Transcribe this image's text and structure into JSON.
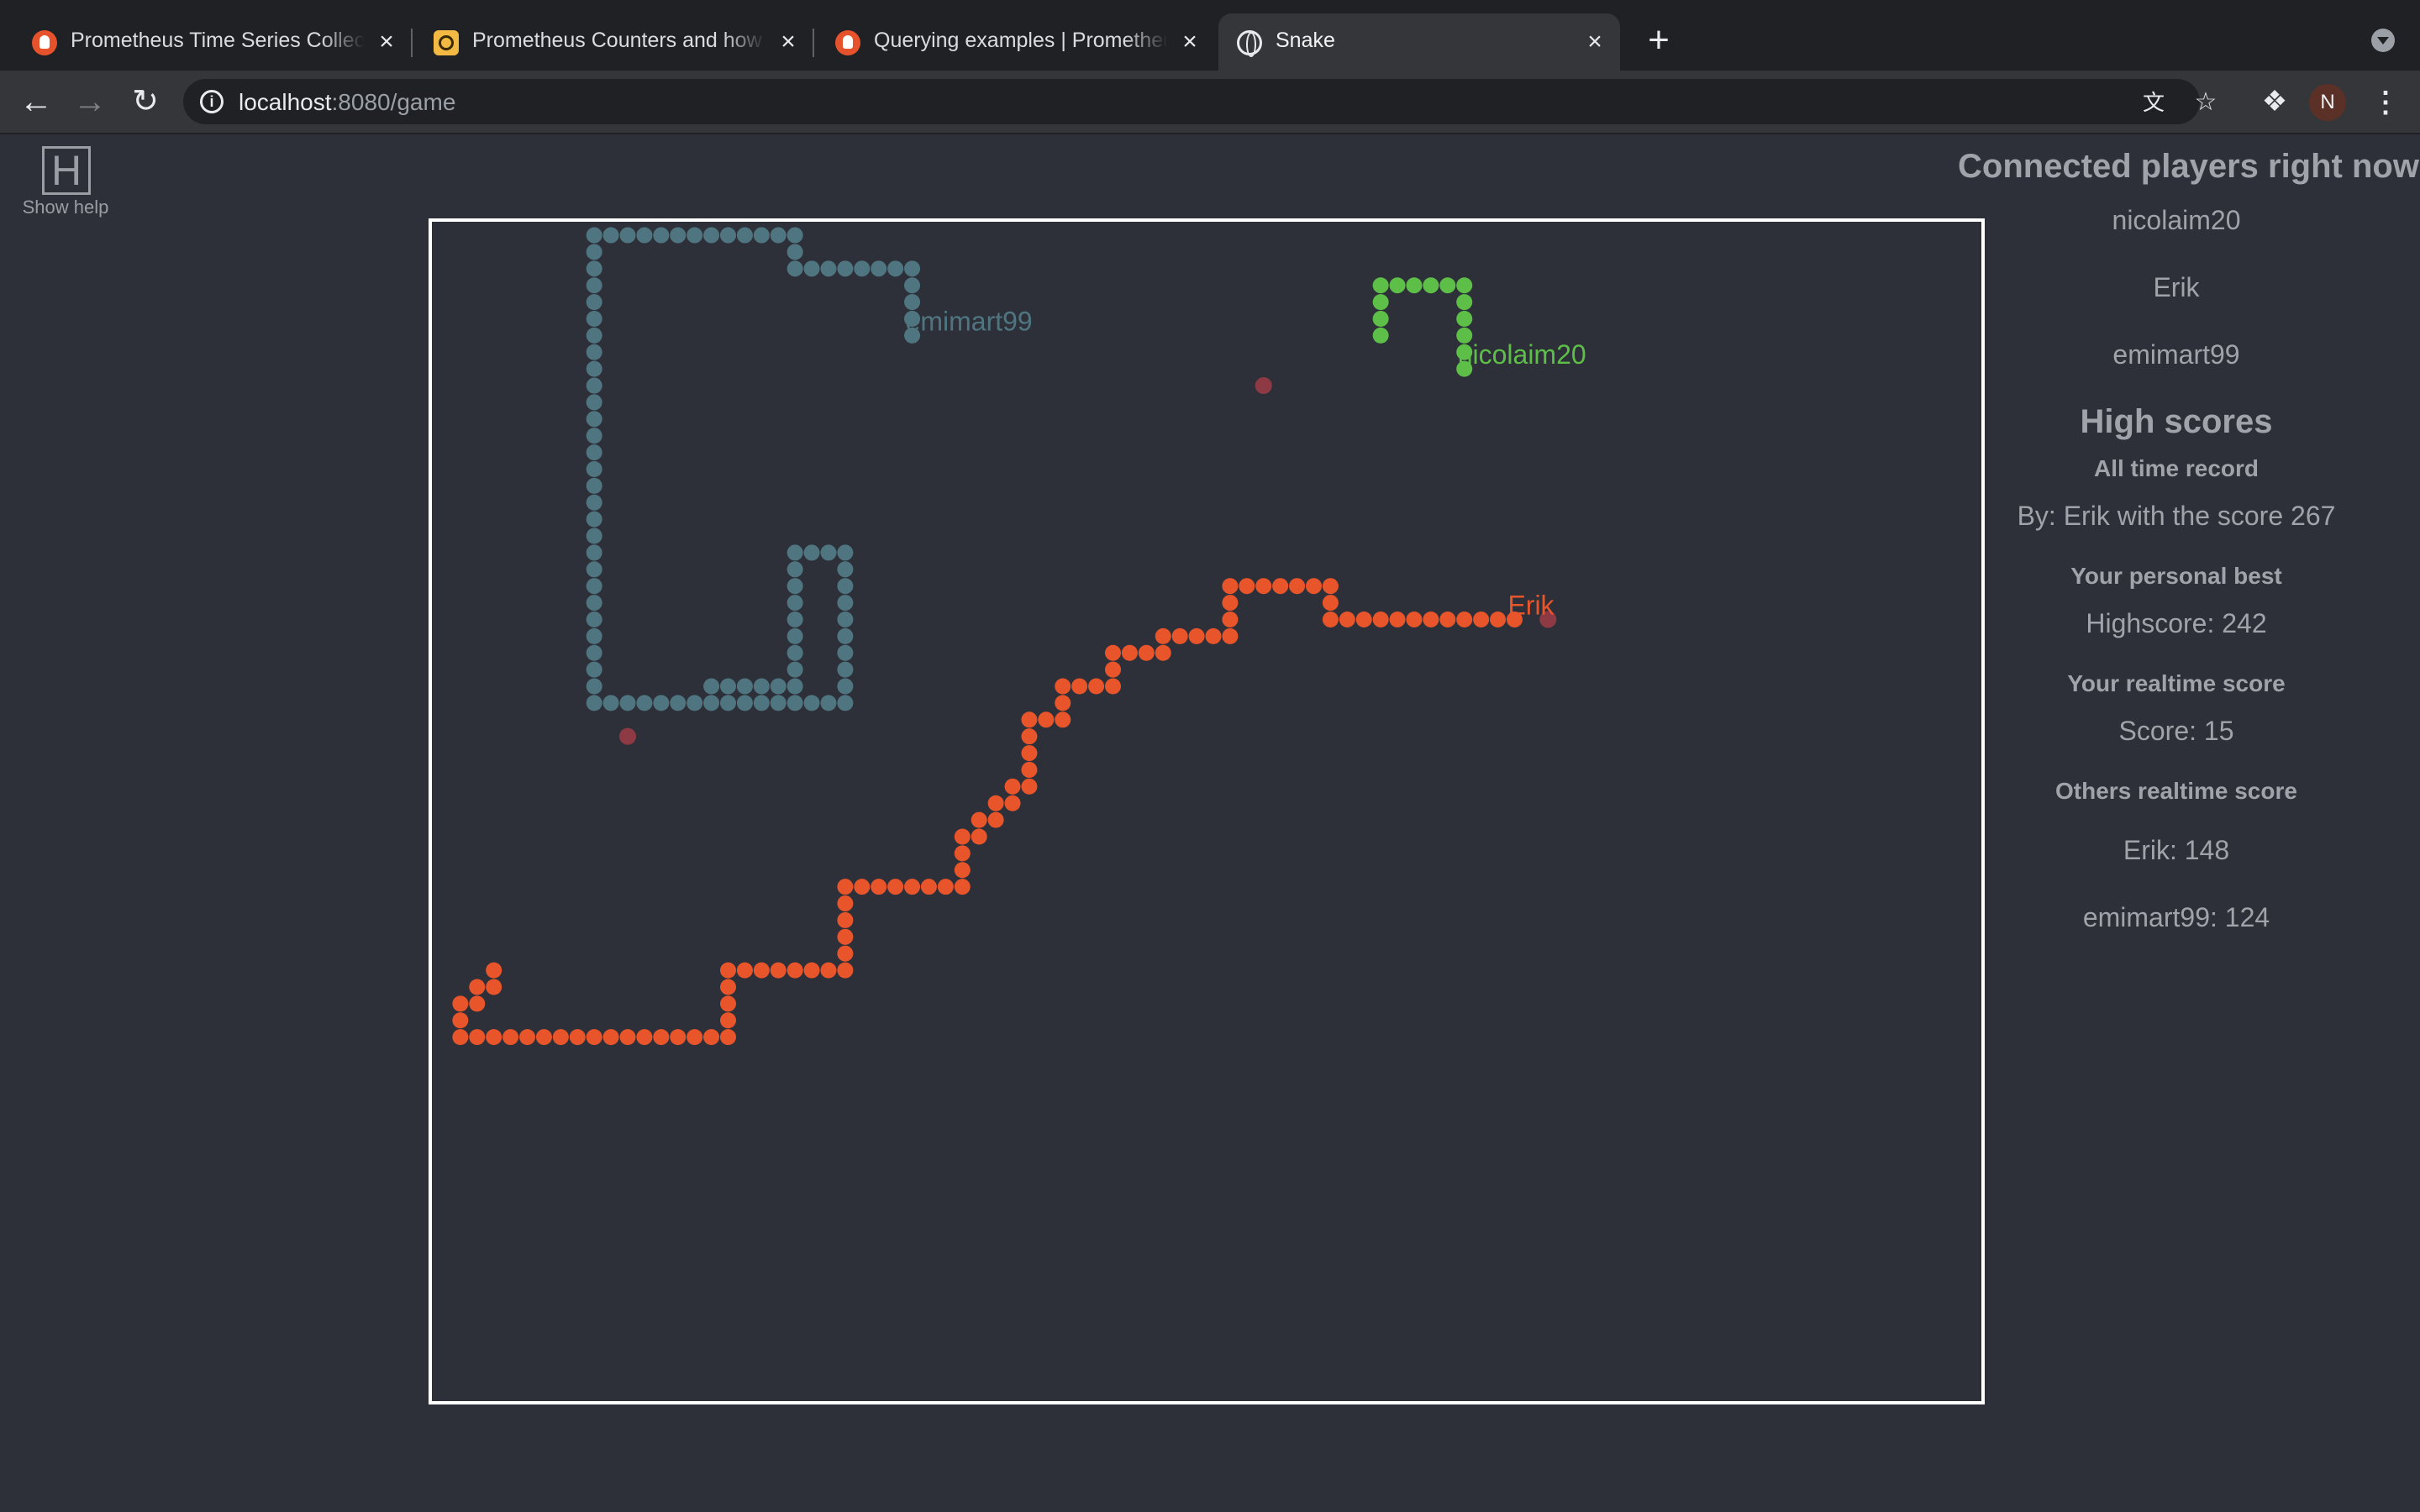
{
  "browser": {
    "tabs": [
      {
        "title": "Prometheus Time Series Collection and Processing Server",
        "icon": "prometheus-icon",
        "active": false
      },
      {
        "title": "Prometheus Counters and how to deal with them",
        "icon": "q-site-icon",
        "active": false
      },
      {
        "title": "Querying examples | Prometheus",
        "icon": "prometheus-icon",
        "active": false
      },
      {
        "title": "Snake",
        "icon": "globe-icon",
        "active": true
      }
    ],
    "url_host": "localhost",
    "url_path": ":8080/game",
    "profile_initial": "N"
  },
  "help": {
    "key": "H",
    "label": "Show help"
  },
  "sidebar": {
    "connected_heading": "Connected players right now",
    "connected_players": [
      "nicolaim20",
      "Erik",
      "emimart99"
    ],
    "high_scores_heading": "High scores",
    "all_time_heading": "All time record",
    "all_time_text": "By: Erik with the score 267",
    "personal_best_heading": "Your personal best",
    "personal_best_text": "Highscore: 242",
    "realtime_heading": "Your realtime score",
    "realtime_text": "Score: 15",
    "others_heading": "Others realtime score",
    "others_scores": [
      "Erik: 148",
      "emimart99: 124"
    ]
  },
  "game": {
    "board_cells": {
      "cols": 93,
      "rows": 71
    },
    "colors": {
      "board_bg": "#2e3039",
      "border": "#ffffff",
      "food": "#8e3a45"
    },
    "food": [
      [
        11,
        29
      ],
      [
        49,
        8
      ],
      [
        66,
        22
      ]
    ],
    "snakes": [
      {
        "name": "emimart99",
        "color": "#4f7680",
        "path": [
          [
            28,
            5
          ],
          [
            28,
            1
          ],
          [
            21,
            1
          ],
          [
            21,
            -1
          ],
          [
            9,
            -1
          ],
          [
            9,
            27
          ],
          [
            24,
            27
          ],
          [
            24,
            18
          ],
          [
            21,
            18
          ],
          [
            21,
            26
          ],
          [
            16,
            26
          ]
        ]
      },
      {
        "name": "nicolaim20",
        "color": "#5dbf48",
        "path": [
          [
            61,
            7
          ],
          [
            61,
            2
          ],
          [
            56,
            2
          ],
          [
            56,
            5
          ]
        ]
      },
      {
        "name": "Erik",
        "color": "#e8552b",
        "path": [
          [
            64,
            22
          ],
          [
            53,
            22
          ],
          [
            53,
            20
          ],
          [
            47,
            20
          ],
          [
            47,
            23
          ],
          [
            43,
            23
          ],
          [
            43,
            24
          ],
          [
            40,
            24
          ],
          [
            40,
            26
          ],
          [
            37,
            26
          ],
          [
            37,
            28
          ],
          [
            35,
            28
          ],
          [
            35,
            32
          ],
          [
            34,
            32
          ],
          [
            34,
            33
          ],
          [
            33,
            33
          ],
          [
            33,
            34
          ],
          [
            32,
            34
          ],
          [
            32,
            35
          ],
          [
            31,
            35
          ],
          [
            31,
            38
          ],
          [
            24,
            38
          ],
          [
            24,
            43
          ],
          [
            17,
            43
          ],
          [
            17,
            47
          ],
          [
            1,
            47
          ],
          [
            1,
            45
          ],
          [
            2,
            45
          ],
          [
            2,
            44
          ],
          [
            3,
            44
          ],
          [
            3,
            43
          ]
        ]
      }
    ]
  }
}
